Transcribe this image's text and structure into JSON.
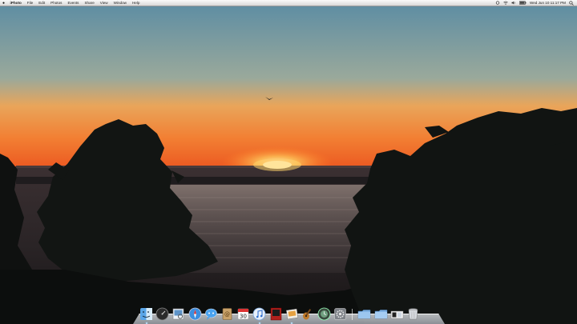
{
  "menubar": {
    "app_name": "iPhoto",
    "items": [
      "File",
      "Edit",
      "Photos",
      "Events",
      "Share",
      "View",
      "Window",
      "Help"
    ],
    "clock": "Wed Jun 10  11:17 PM"
  },
  "dock": {
    "calendar_date": "30",
    "apps": [
      "finder-icon",
      "dashboard-icon",
      "preview-icon",
      "safari-icon",
      "ichat-icon",
      "address-book-icon",
      "itunes-icon",
      "photo-booth-icon",
      "iphoto-icon",
      "garageband-icon",
      "time-machine-icon",
      "system-preferences-icon"
    ],
    "folders": [
      "applications-folder-icon",
      "documents-folder-icon",
      "downloads-stack-icon",
      "trash-icon"
    ]
  },
  "colors": {
    "sky_top": "#5f8ea3",
    "sky_horizon": "#f0762e",
    "sun": "#fff4c4",
    "water": "#2a2424"
  }
}
